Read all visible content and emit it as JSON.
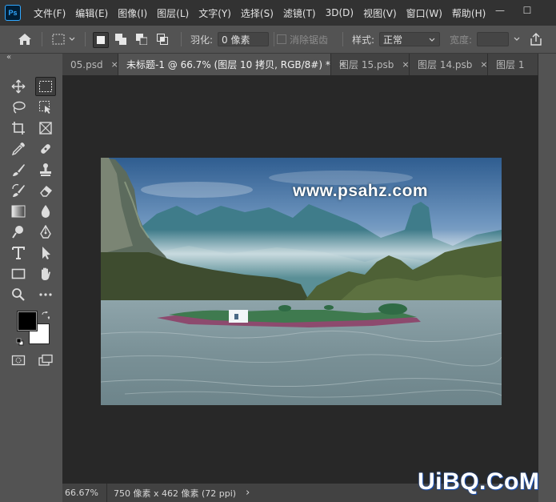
{
  "app": {
    "logo_text": "Ps"
  },
  "menu": [
    "文件(F)",
    "编辑(E)",
    "图像(I)",
    "图层(L)",
    "文字(Y)",
    "选择(S)",
    "滤镜(T)",
    "3D(D)",
    "视图(V)",
    "窗口(W)",
    "帮助(H)"
  ],
  "window_controls": {
    "minimize": "—",
    "maximize": "☐"
  },
  "options": {
    "feather_label": "羽化:",
    "feather_value": "0 像素",
    "antialias_label": "消除锯齿",
    "style_label": "样式:",
    "style_value": "正常",
    "width_label": "宽度:"
  },
  "panel_collapse": "«",
  "tabs": [
    {
      "label": "05.psd",
      "close": "×"
    },
    {
      "label": "未标题-1 @ 66.7% (图层 10 拷贝, RGB/8#) *",
      "close": "×"
    },
    {
      "label": "图层 15.psb",
      "close": "×"
    },
    {
      "label": "图层 14.psb",
      "close": "×"
    },
    {
      "label": "图层 1"
    }
  ],
  "canvas": {
    "watermark": "www.psahz.com"
  },
  "status": {
    "zoom": "66.67%",
    "info": "750 像素 x 462 像素 (72 ppi)",
    "arrow": "›"
  },
  "site_logo": "UiBQ.CoM",
  "colors": {
    "foreground": "#000000",
    "background": "#ffffff",
    "accent": "#31a8ff"
  }
}
